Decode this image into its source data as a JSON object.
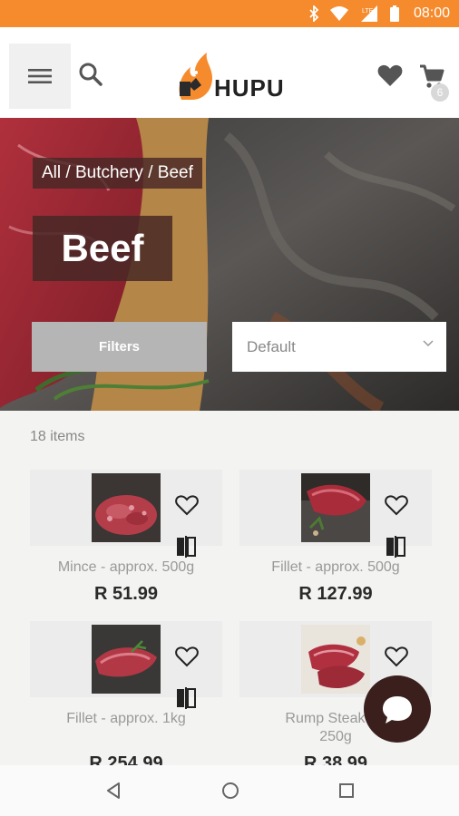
{
  "status_bar": {
    "time": "08:00",
    "network": "LTE"
  },
  "header": {
    "logo_text": "HUPU",
    "cart_count": "6"
  },
  "hero": {
    "breadcrumb": "All / Butchery / Beef",
    "title": "Beef",
    "filters_label": "Filters",
    "sort_value": "Default"
  },
  "list": {
    "count_label": "18 items",
    "products": [
      {
        "name": "Mince - approx. 500g",
        "price": "R 51.99",
        "image": "minced-beef"
      },
      {
        "name": "Fillet - approx. 500g",
        "price": "R 127.99",
        "image": "beef-fillet-on-board"
      },
      {
        "name": "Fillet - approx. 1kg",
        "price": "R 254.99",
        "image": "beef-fillet-with-herbs"
      },
      {
        "name": "Rump Steak - approx. 250g",
        "name_line1": "Rump Steak - a",
        "name_line2": "250g",
        "price": "R 38.99",
        "image": "rump-steak"
      }
    ]
  },
  "colors": {
    "status_bar": "#f68b2d",
    "overlay_brown": "#482826",
    "chat": "#3a1f1d"
  }
}
